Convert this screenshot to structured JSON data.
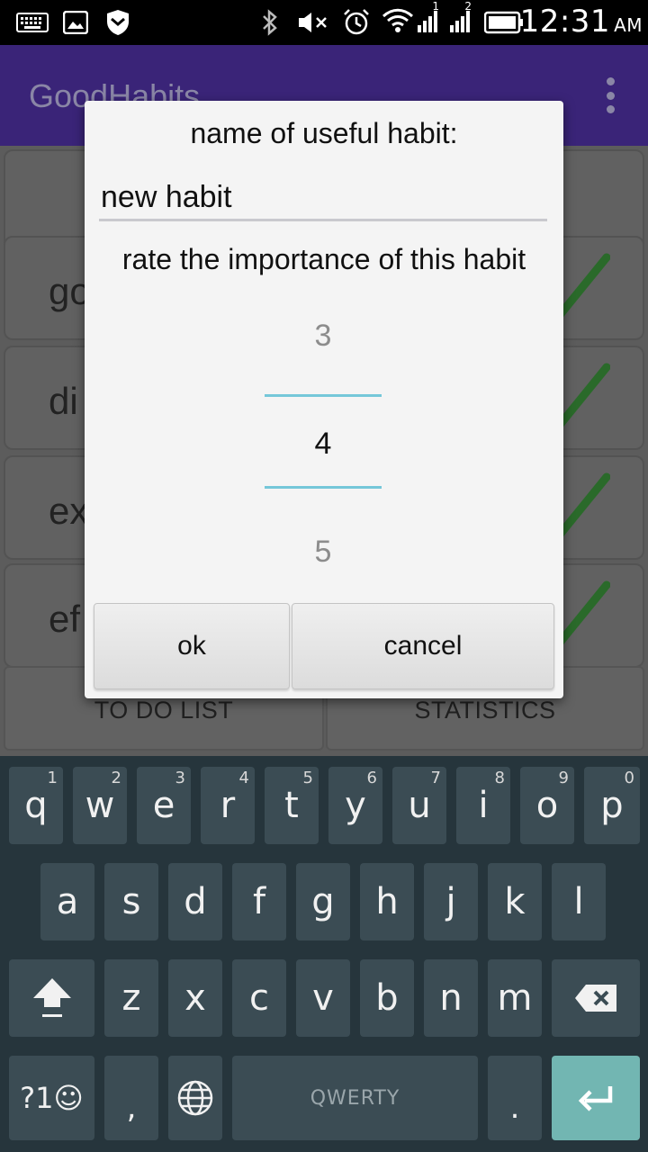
{
  "status_bar": {
    "time": "12:31",
    "ampm": "AM",
    "icons": [
      "keyboard-icon",
      "image-icon",
      "shield-icon",
      "bluetooth-icon",
      "mute-icon",
      "alarm-icon",
      "wifi-icon",
      "signal-1-icon",
      "signal-2-icon",
      "battery-icon"
    ],
    "signal_1_label": "1",
    "signal_2_label": "2"
  },
  "app_bar": {
    "title": "GoodHabits"
  },
  "habit_list": {
    "rows": [
      {
        "label": "",
        "checked": false
      },
      {
        "label": "go",
        "checked": true
      },
      {
        "label": "di",
        "checked": true
      },
      {
        "label": "ex",
        "checked": true
      },
      {
        "label": "ef",
        "checked": true
      }
    ],
    "check_color": "#2a6a2a"
  },
  "bottom_nav": {
    "todo_label": "TO DO LIST",
    "stats_label": "STATISTICS"
  },
  "dialog": {
    "title": "name of useful habit:",
    "input_value": "new habit",
    "rate_label": "rate the importance of this habit",
    "picker": {
      "prev": "3",
      "selected": "4",
      "next": "5"
    },
    "accent": "#75c7d9",
    "ok_label": "ok",
    "cancel_label": "cancel"
  },
  "keyboard": {
    "row1": [
      {
        "k": "q",
        "n": "1"
      },
      {
        "k": "w",
        "n": "2"
      },
      {
        "k": "e",
        "n": "3"
      },
      {
        "k": "r",
        "n": "4"
      },
      {
        "k": "t",
        "n": "5"
      },
      {
        "k": "y",
        "n": "6"
      },
      {
        "k": "u",
        "n": "7"
      },
      {
        "k": "i",
        "n": "8"
      },
      {
        "k": "o",
        "n": "9"
      },
      {
        "k": "p",
        "n": "0"
      }
    ],
    "row2": [
      "a",
      "s",
      "d",
      "f",
      "g",
      "h",
      "j",
      "k",
      "l"
    ],
    "row3": [
      "z",
      "x",
      "c",
      "v",
      "b",
      "n",
      "m"
    ],
    "symbols_label": "?1☺",
    "comma_label": ",",
    "space_label": "QWERTY",
    "period_label": ".",
    "enter_color": "#72b6b2"
  }
}
